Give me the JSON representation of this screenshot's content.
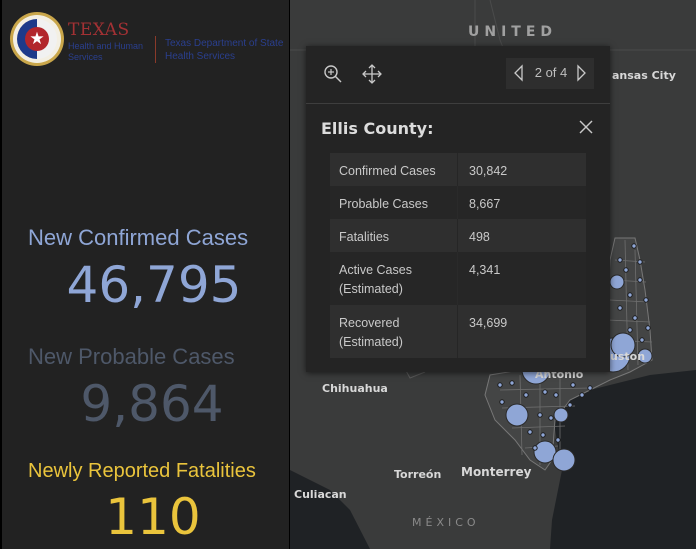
{
  "header": {
    "logo": {
      "org_title": "TEXAS",
      "org_subtitle": "Health and Human Services",
      "dept_name": "Texas Department of State Health Services",
      "seal_icon": "texas-star-seal"
    }
  },
  "stats": [
    {
      "label": "New Confirmed Cases",
      "value": "46,795",
      "color": "#8fa6d6"
    },
    {
      "label": "New Probable Cases",
      "value": "9,864",
      "color": "#4e5869"
    },
    {
      "label": "Newly Reported Fatalities",
      "value": "110",
      "color": "#eac43c"
    }
  ],
  "map": {
    "labels": {
      "country_us": "UNITED",
      "country_mx": "MÉXICO",
      "kansas_city": "ansas City",
      "chihuahua": "Chihuahua",
      "torreon": "Torreón",
      "monterrey": "Monterrey",
      "culiacan": "Culiacan",
      "san_antonio": "Antonio",
      "houston": "uston"
    },
    "symbol_color": "#8fa6d6"
  },
  "popup": {
    "toolbar": {
      "zoom_icon": "zoom-in-icon",
      "pan_icon": "move-icon",
      "pager_text": "2 of 4"
    },
    "title": "Ellis County:",
    "rows": [
      {
        "label": "Confirmed Cases",
        "value": "30,842"
      },
      {
        "label": "Probable Cases",
        "value": "8,667"
      },
      {
        "label": "Fatalities",
        "value": "498"
      },
      {
        "label": "Active Cases (Estimated)",
        "value": "4,341"
      },
      {
        "label": "Recovered (Estimated)",
        "value": "34,699"
      }
    ]
  }
}
